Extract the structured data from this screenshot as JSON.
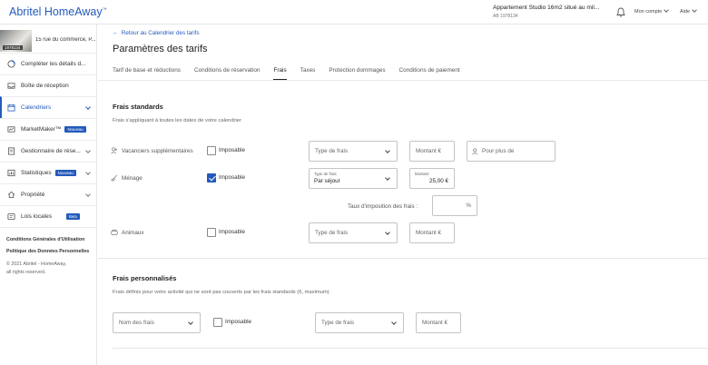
{
  "header": {
    "logo": "Abritel HomeAway",
    "logo_tm": "™",
    "property_title": "Appartement Studio 16m2 situé au mil...",
    "property_id": "AB 1978134",
    "account_label": "Mon compte",
    "help_label": "Aide"
  },
  "sidebar": {
    "property_id_badge": "1978134",
    "property_address": "15 rue du commerce, P...",
    "items": [
      {
        "label": "Compléter les détails d...",
        "icon": "progress-icon",
        "chevron": false,
        "badge": ""
      },
      {
        "label": "Boîte de réception",
        "icon": "inbox-icon",
        "chevron": false,
        "badge": ""
      },
      {
        "label": "Calendriers",
        "icon": "calendar-icon",
        "chevron": true,
        "badge": "",
        "active": true
      },
      {
        "label": "MarketMaker™",
        "icon": "marketmaker-icon",
        "chevron": false,
        "badge": "Nouveau"
      },
      {
        "label": "Gestionnaire de rése...",
        "icon": "reservation-manager-icon",
        "chevron": true,
        "badge": ""
      },
      {
        "label": "Statistiques",
        "icon": "chart-icon",
        "chevron": true,
        "badge": "Nouveau"
      },
      {
        "label": "Propriété",
        "icon": "property-icon",
        "chevron": true,
        "badge": ""
      },
      {
        "label": "Lois locales",
        "icon": "law-icon",
        "chevron": false,
        "badge": "Beta"
      }
    ],
    "links": [
      "Conditions Générales d'Utilisation",
      "Politique des Données Personnelles"
    ],
    "copyright_1": "© 2021 Abritel - HomeAway,",
    "copyright_2": "all rights reserved."
  },
  "main": {
    "back_link": "Retour au Calendrier des tarifs",
    "title": "Paramètres des tarifs",
    "tabs": [
      {
        "label": "Tarif de base et réductions"
      },
      {
        "label": "Conditions de réservation"
      },
      {
        "label": "Frais",
        "active": true
      },
      {
        "label": "Taxes"
      },
      {
        "label": "Protection dommages"
      },
      {
        "label": "Conditions de paiement"
      }
    ],
    "standard": {
      "title": "Frais standards",
      "desc": "Frais s'appliquant à toutes les dates de votre calendrier",
      "rows": [
        {
          "label": "Vacanciers supplémentaires",
          "icon": "person-plus-icon",
          "taxable_label": "Imposable",
          "checked": false,
          "type_placeholder": "Type de frais",
          "amount_placeholder": "Montant €",
          "extra_placeholder": "Pour plus de"
        },
        {
          "label": "Ménage",
          "icon": "broom-icon",
          "taxable_label": "Imposable",
          "checked": true,
          "type_label": "Type de frais",
          "type_value": "Par séjour",
          "amount_label": "Montant",
          "amount_value": "25,00 €"
        },
        {
          "label": "Animaux",
          "icon": "pet-icon",
          "taxable_label": "Imposable",
          "checked": false,
          "type_placeholder": "Type de frais",
          "amount_placeholder": "Montant €"
        }
      ],
      "tax_rate_label": "Taux d'imposition des frais :",
      "tax_rate_suffix": "%"
    },
    "custom": {
      "title": "Frais personnalisés",
      "desc": "Frais définis pour votre activité qui ne sont pas couverts par les frais standards (6, maximum)",
      "name_placeholder": "Nom des frais",
      "taxable_label": "Imposable",
      "type_placeholder": "Type de frais",
      "amount_placeholder": "Montant €"
    }
  },
  "colors": {
    "accent": "#245abc",
    "border": "#c4c4c4"
  }
}
